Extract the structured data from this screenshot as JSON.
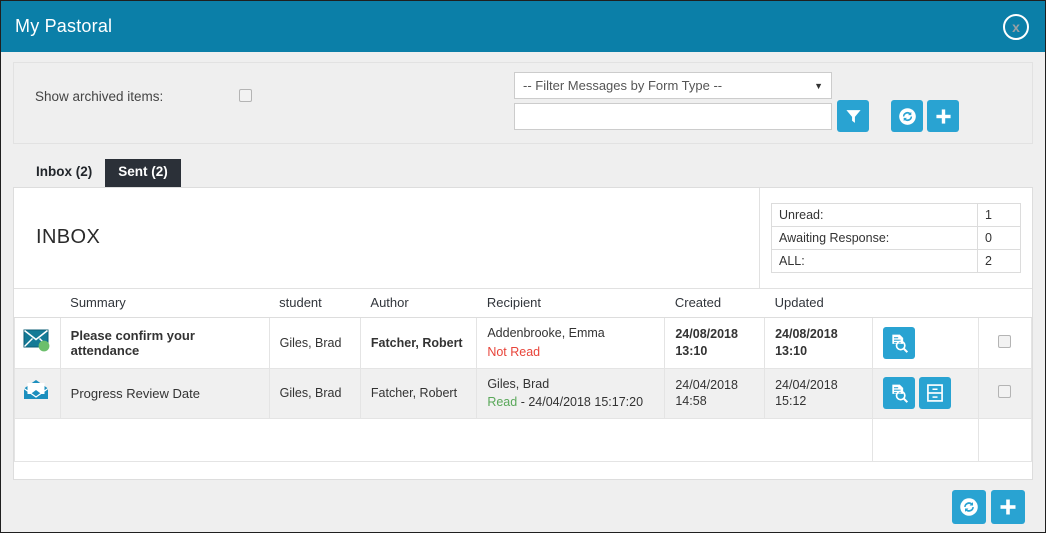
{
  "window": {
    "title": "My Pastoral",
    "close_label": "x"
  },
  "filter": {
    "archived_label": "Show archived items:",
    "form_type_selected": "-- Filter Messages by Form Type --",
    "search_value": "",
    "search_placeholder": "",
    "filter_button": "filter-icon",
    "refresh_button": "refresh-icon",
    "add_button": "add-icon"
  },
  "tabs": [
    {
      "label": "Inbox (2)",
      "active": true
    },
    {
      "label": "Sent (2)",
      "active": false
    }
  ],
  "panel": {
    "title": "INBOX",
    "stats": [
      {
        "label": "Unread:",
        "value": "1"
      },
      {
        "label": "Awaiting Response:",
        "value": "0"
      },
      {
        "label": "ALL:",
        "value": "2"
      }
    ]
  },
  "table": {
    "columns": [
      "",
      "Summary",
      "student",
      "Author",
      "Recipient",
      "Created",
      "Updated",
      "",
      ""
    ],
    "rows": [
      {
        "icon": "envelope-closed-icon",
        "unread": true,
        "summary": "Please confirm your attendance",
        "student": "Giles, Brad",
        "author": "Fatcher, Robert",
        "recipient": "Addenbrooke, Emma",
        "recipient_status": "Not Read",
        "recipient_status_detail": "",
        "created_date": "24/08/2018",
        "created_time": "13:10",
        "updated_date": "24/08/2018",
        "updated_time": "13:10",
        "actions": [
          "view-document-icon"
        ]
      },
      {
        "icon": "envelope-open-icon",
        "unread": false,
        "summary": "Progress Review Date",
        "student": "Giles, Brad",
        "author": "Fatcher, Robert",
        "recipient": "Giles, Brad",
        "recipient_status": "Read",
        "recipient_status_detail": " - 24/04/2018 15:17:20",
        "created_date": "24/04/2018",
        "created_time": "14:58",
        "updated_date": "24/04/2018",
        "updated_time": "15:12",
        "actions": [
          "view-document-icon",
          "archive-icon"
        ]
      }
    ]
  },
  "footer": {
    "refresh_button": "refresh-icon",
    "add_button": "add-icon"
  },
  "colors": {
    "titlebar": "#0b7fa8",
    "accent_button": "#29a3d2",
    "tab_inactive_bg": "#2b3038",
    "status_not_read": "#e8443a",
    "status_read": "#5aa85a",
    "envelope_closed": "#147a96",
    "envelope_open": "#1c8fbe",
    "unread_dot": "#6cbf6c"
  }
}
